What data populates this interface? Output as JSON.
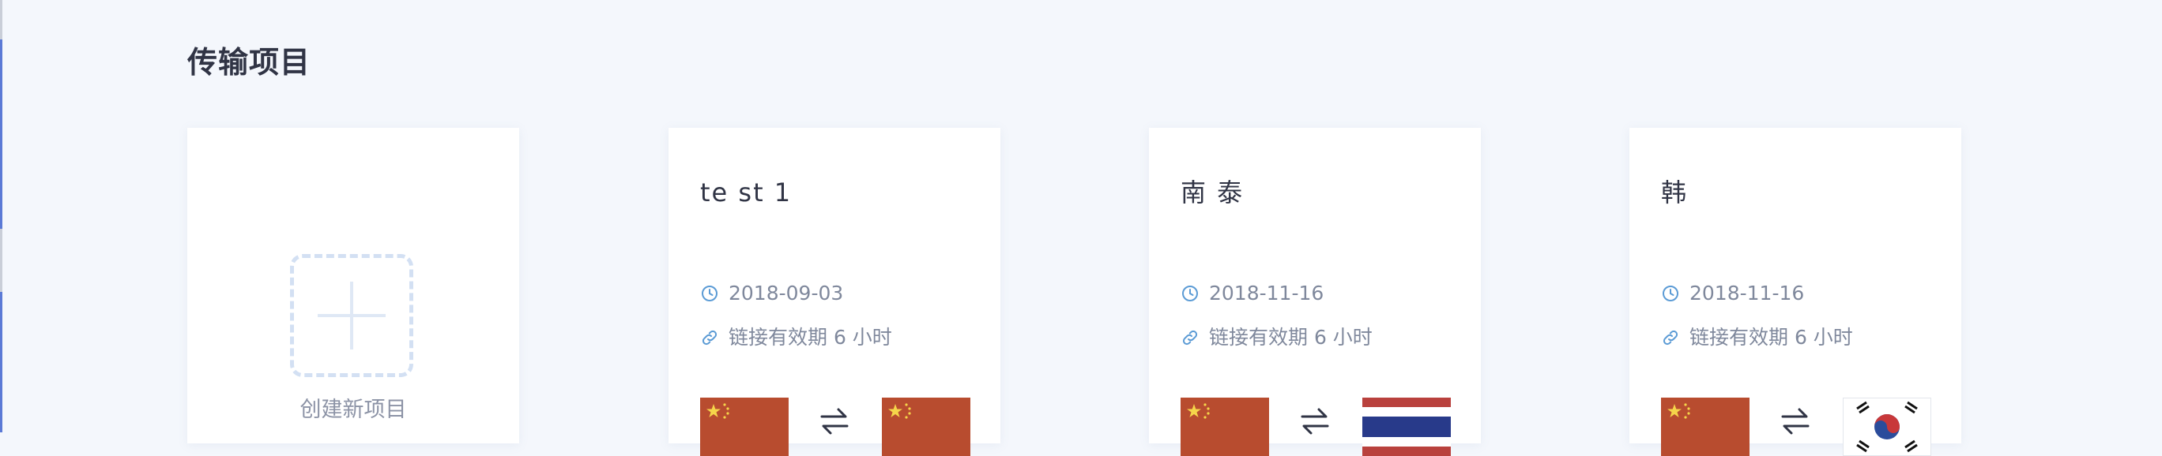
{
  "page": {
    "title": "传输项目",
    "background": "#f4f7fc"
  },
  "create_card": {
    "label": "创建新项目",
    "icon": "plus-icon"
  },
  "projects": [
    {
      "name": "te st 1",
      "date": "2018-09-03",
      "link_validity": "链接有效期 6 小时",
      "source_flag": "china-flag-icon",
      "target_flag": "china-flag-icon"
    },
    {
      "name": "南 泰",
      "date": "2018-11-16",
      "link_validity": "链接有效期 6 小时",
      "source_flag": "china-flag-icon",
      "target_flag": "thailand-flag-icon"
    },
    {
      "name": "韩",
      "date": "2018-11-16",
      "link_validity": "链接有效期 6 小时",
      "source_flag": "china-flag-icon",
      "target_flag": "south-korea-flag-icon"
    }
  ],
  "colors": {
    "accent": "#5b9bd5",
    "text_primary": "#303445",
    "text_secondary": "#7f889c",
    "dashed_border": "#d3e0f3"
  }
}
